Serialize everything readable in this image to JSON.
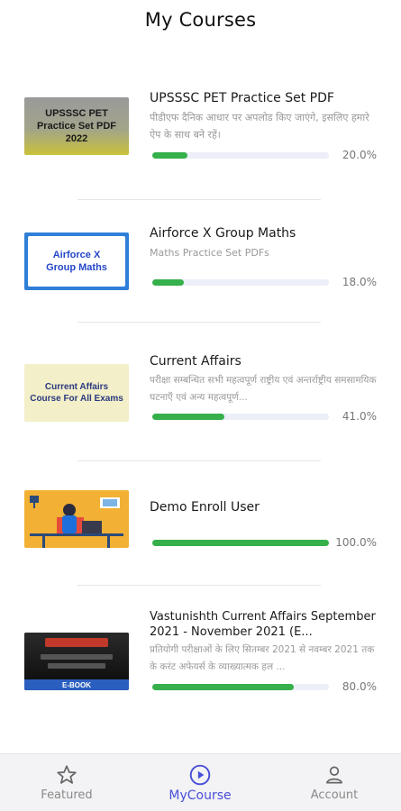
{
  "header": {
    "title": "My Courses"
  },
  "courses": [
    {
      "title": "UPSSSC PET Practice Set PDF",
      "desc": "पीडीएफ दैनिक आधार पर अपलोड किए जाएंगे, इसलिए हमारे ऐप के साथ बने रहें।",
      "progress": 20,
      "progress_label": "20.0%",
      "thumb_text": "UPSSSC PET Practice Set PDF 2022"
    },
    {
      "title": "Airforce X Group Maths",
      "desc": "Maths Practice Set PDFs",
      "progress": 18,
      "progress_label": "18.0%",
      "thumb_text": "Airforce X Group Maths"
    },
    {
      "title": "Current Affairs",
      "desc": "परीक्षा सम्बन्धित सभी महत्वपूर्ण राष्ट्रीय एवं अन्तर्राष्ट्रीय समसामयिक घटनाएँ एवं अन्य महत्वपूर्ण...",
      "progress": 41,
      "progress_label": "41.0%",
      "thumb_text": "Current Affairs Course For All Exams"
    },
    {
      "title": "Demo Enroll User",
      "desc": "",
      "progress": 100,
      "progress_label": "100.0%"
    },
    {
      "title": "Vastunishth Current Affairs September 2021 - November 2021 (E...",
      "desc": "प्रतियोगी परीक्षाओं के लिए सितम्बर 2021 से नवम्बर 2021 तक के करंट अफेयर्स के व्याख्यात्मक हल ...",
      "progress": 80,
      "progress_label": "80.0%",
      "thumb_text": "E-BOOK"
    }
  ],
  "tabs": [
    {
      "label": "Featured",
      "icon": "star-icon"
    },
    {
      "label": "MyCourse",
      "icon": "play-circle-icon",
      "active": true
    },
    {
      "label": "Account",
      "icon": "user-icon"
    }
  ],
  "colors": {
    "accent": "#4a4fd8",
    "progress": "#35b04b",
    "track": "#eceef8"
  }
}
